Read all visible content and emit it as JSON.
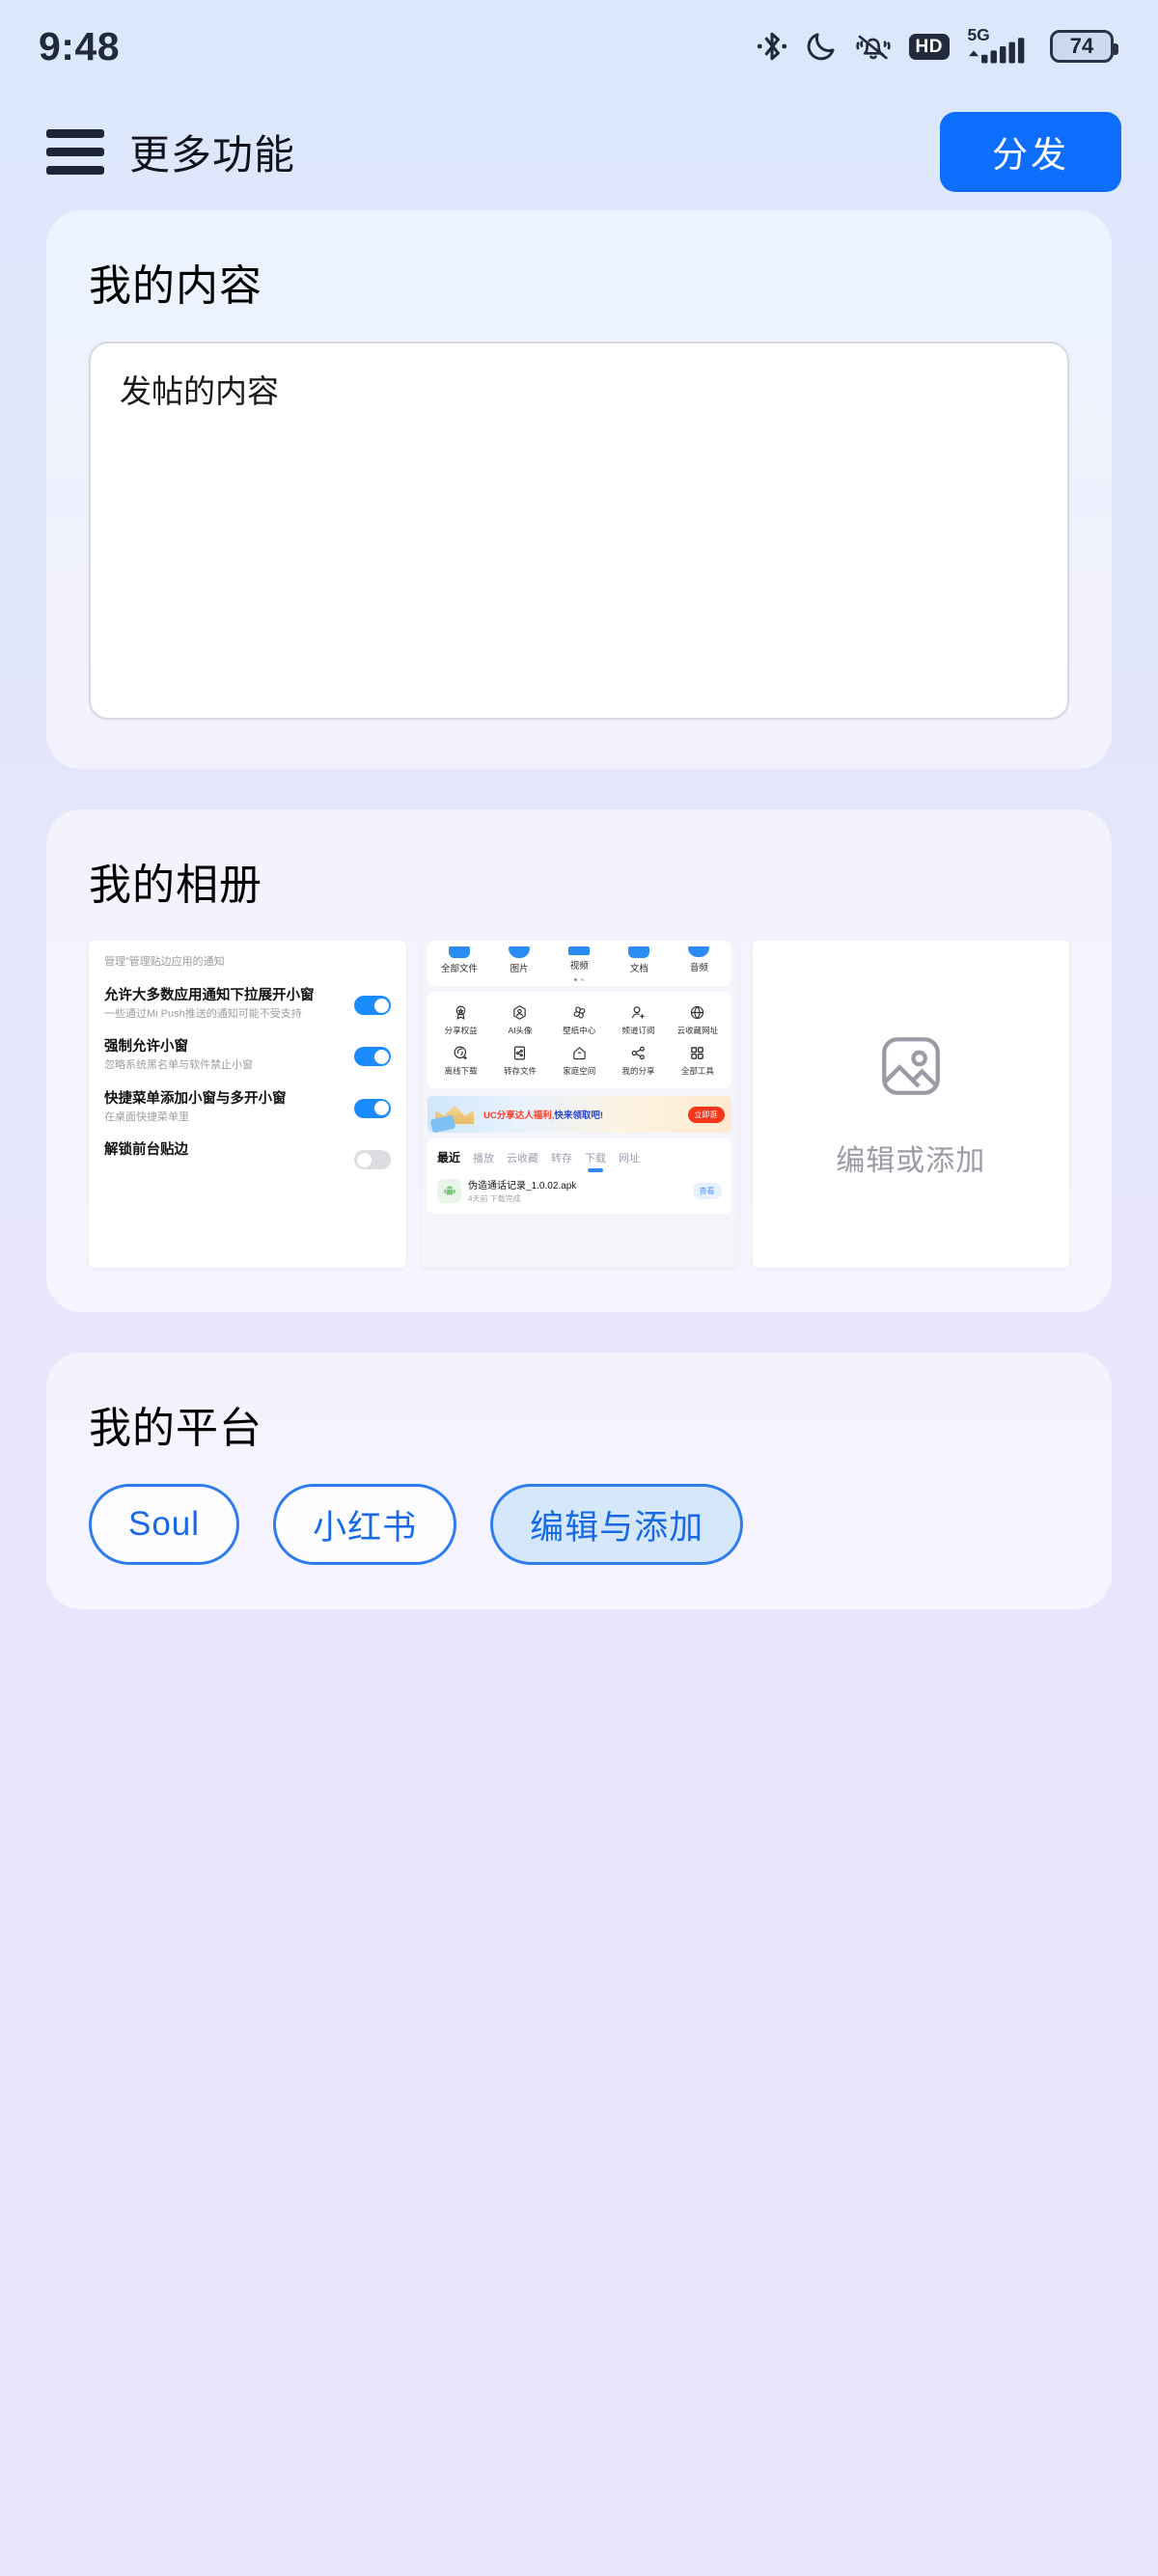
{
  "status_bar": {
    "time": "9:48",
    "battery_level": "74",
    "network_label": "5G",
    "hd_label": "HD",
    "icons": [
      "bluetooth-icon",
      "do-not-disturb-moon-icon",
      "mute-vibrate-bell-icon",
      "hd-icon",
      "signal-5g-icon",
      "battery-icon"
    ]
  },
  "header": {
    "title": "更多功能",
    "menu_icon": "hamburger-menu-icon",
    "primary_button": "分发"
  },
  "content_card": {
    "title": "我的内容",
    "textarea_value": "发帖的内容",
    "textarea_placeholder": "发帖的内容"
  },
  "album_card": {
    "title": "我的相册",
    "add_tile": {
      "label": "编辑或添加",
      "icon": "image-placeholder-icon"
    },
    "thumb_settings": {
      "header_note": "管理”管理贴边应用的通知",
      "rows": [
        {
          "title": "允许大多数应用通知下拉展开小窗",
          "subtitle": "一些通过Mi Push推送的通知可能不受支持",
          "toggle": "on"
        },
        {
          "title": "强制允许小窗",
          "subtitle": "忽略系统黑名单与软件禁止小窗",
          "toggle": "on"
        },
        {
          "title": "快捷菜单添加小窗与多开小窗",
          "subtitle": "在桌面快捷菜单里",
          "toggle": "on"
        },
        {
          "title": "解锁前台贴边",
          "subtitle": "",
          "toggle": "off"
        }
      ]
    },
    "thumb_filemanager": {
      "top_tabs": [
        "全部文件",
        "图片",
        "视频",
        "文档",
        "音频"
      ],
      "tools": [
        "分享权益",
        "AI头像",
        "壁纸中心",
        "频道订阅",
        "云收藏网址",
        "离线下载",
        "转存文件",
        "家庭空间",
        "我的分享",
        "全部工具"
      ],
      "banner_text_red": "UC分享达人福利,",
      "banner_text_blue": "快来领取吧!",
      "banner_cta": "立即逛",
      "tabs": [
        "最近",
        "播放",
        "云收藏",
        "转存",
        "下载",
        "网址"
      ],
      "tab_active": "最近",
      "tab_selected": "下载",
      "file_name": "伪造通话记录_1.0.02.apk",
      "file_meta": "4天前 下载完成",
      "file_action": "查看"
    }
  },
  "platform_card": {
    "title": "我的平台",
    "chips": [
      {
        "label": "Soul",
        "filled": false
      },
      {
        "label": "小红书",
        "filled": false
      },
      {
        "label": "编辑与添加",
        "filled": true
      }
    ]
  },
  "colors": {
    "accent": "#0d6efd",
    "chip_border": "#2f7ced",
    "chip_text": "#1769e8",
    "toggle_on": "#1a8cff",
    "page_bg_top": "#dbe7fb",
    "page_bg_bottom": "#e9e6fc"
  }
}
